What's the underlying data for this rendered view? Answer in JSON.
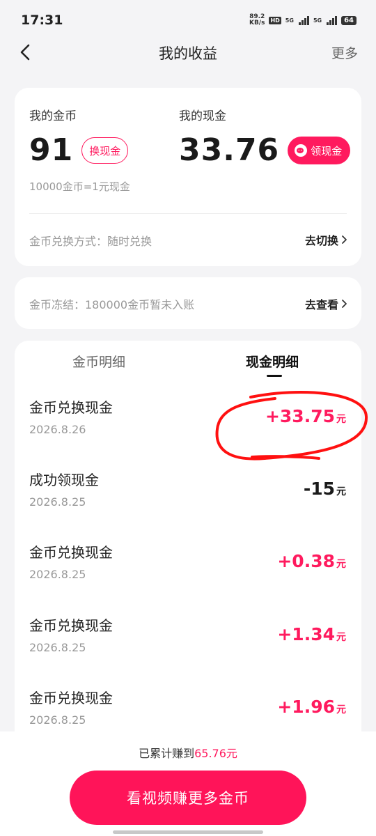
{
  "status_bar": {
    "time": "17:31",
    "net_speed_value": "89.2",
    "net_speed_unit": "KB/s",
    "hd_badge": "HD",
    "sim1_label": "5G",
    "sim2_label": "5G",
    "battery": "64"
  },
  "nav": {
    "title": "我的收益",
    "more": "更多"
  },
  "balance": {
    "coin_label": "我的金币",
    "coin_value": "91",
    "exchange_button": "换现金",
    "cash_label": "我的现金",
    "cash_value": "33.76",
    "withdraw_button": "领现金",
    "rate_note": "10000金币=1元现金",
    "exchange_method": "金币兑换方式：随时兑换",
    "switch_link": "去切换"
  },
  "frozen": {
    "text": "金币冻结：180000金币暂未入账",
    "view_link": "去查看"
  },
  "tabs": {
    "coin_detail": "金币明细",
    "cash_detail": "现金明细",
    "active": "cash_detail"
  },
  "transactions": [
    {
      "title": "金币兑换现金",
      "date": "2026.8.26",
      "amount": "+33.75",
      "unit": "元",
      "positive": true
    },
    {
      "title": "成功领现金",
      "date": "2026.8.25",
      "amount": "-15",
      "unit": "元",
      "positive": false
    },
    {
      "title": "金币兑换现金",
      "date": "2026.8.25",
      "amount": "+0.38",
      "unit": "元",
      "positive": true
    },
    {
      "title": "金币兑换现金",
      "date": "2026.8.25",
      "amount": "+1.34",
      "unit": "元",
      "positive": true
    },
    {
      "title": "金币兑换现金",
      "date": "2026.8.25",
      "amount": "+1.96",
      "unit": "元",
      "positive": true
    }
  ],
  "footer": {
    "total_prefix": "已累计赚到",
    "total_value": "65.76元",
    "cta": "看视频赚更多金币"
  },
  "colors": {
    "accent": "#ff1a5e",
    "annotation": "#ff1010"
  },
  "icons": {
    "back": "chevron-left-icon",
    "chevron": "chevron-right-icon",
    "withdraw": "wechat-icon"
  }
}
